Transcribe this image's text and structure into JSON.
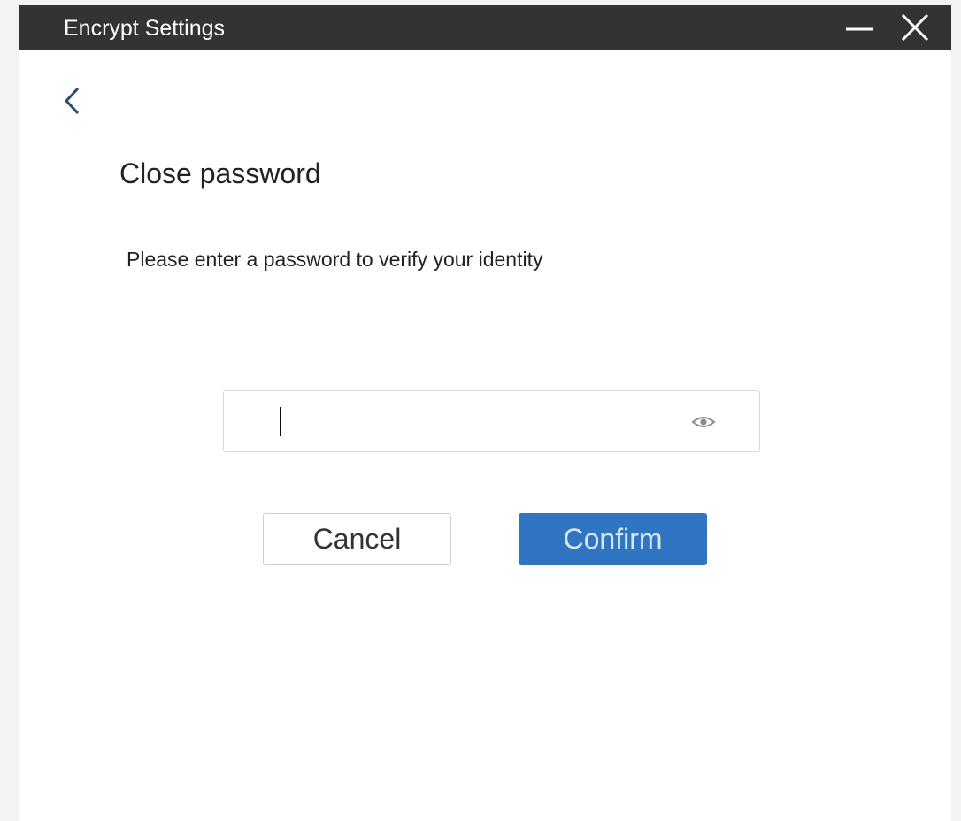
{
  "window": {
    "title": "Encrypt Settings",
    "titlebar_color": "#333333"
  },
  "icons": {
    "minimize": "minimize-icon",
    "close": "close-icon",
    "back": "chevron-left-icon",
    "show_password": "eye-icon"
  },
  "main": {
    "heading": "Close password",
    "instruction": "Please enter a password to verify your identity",
    "password_field": {
      "value": "",
      "placeholder": ""
    },
    "cancel_label": "Cancel",
    "confirm_label": "Confirm",
    "accent_color": "#3075c2"
  }
}
